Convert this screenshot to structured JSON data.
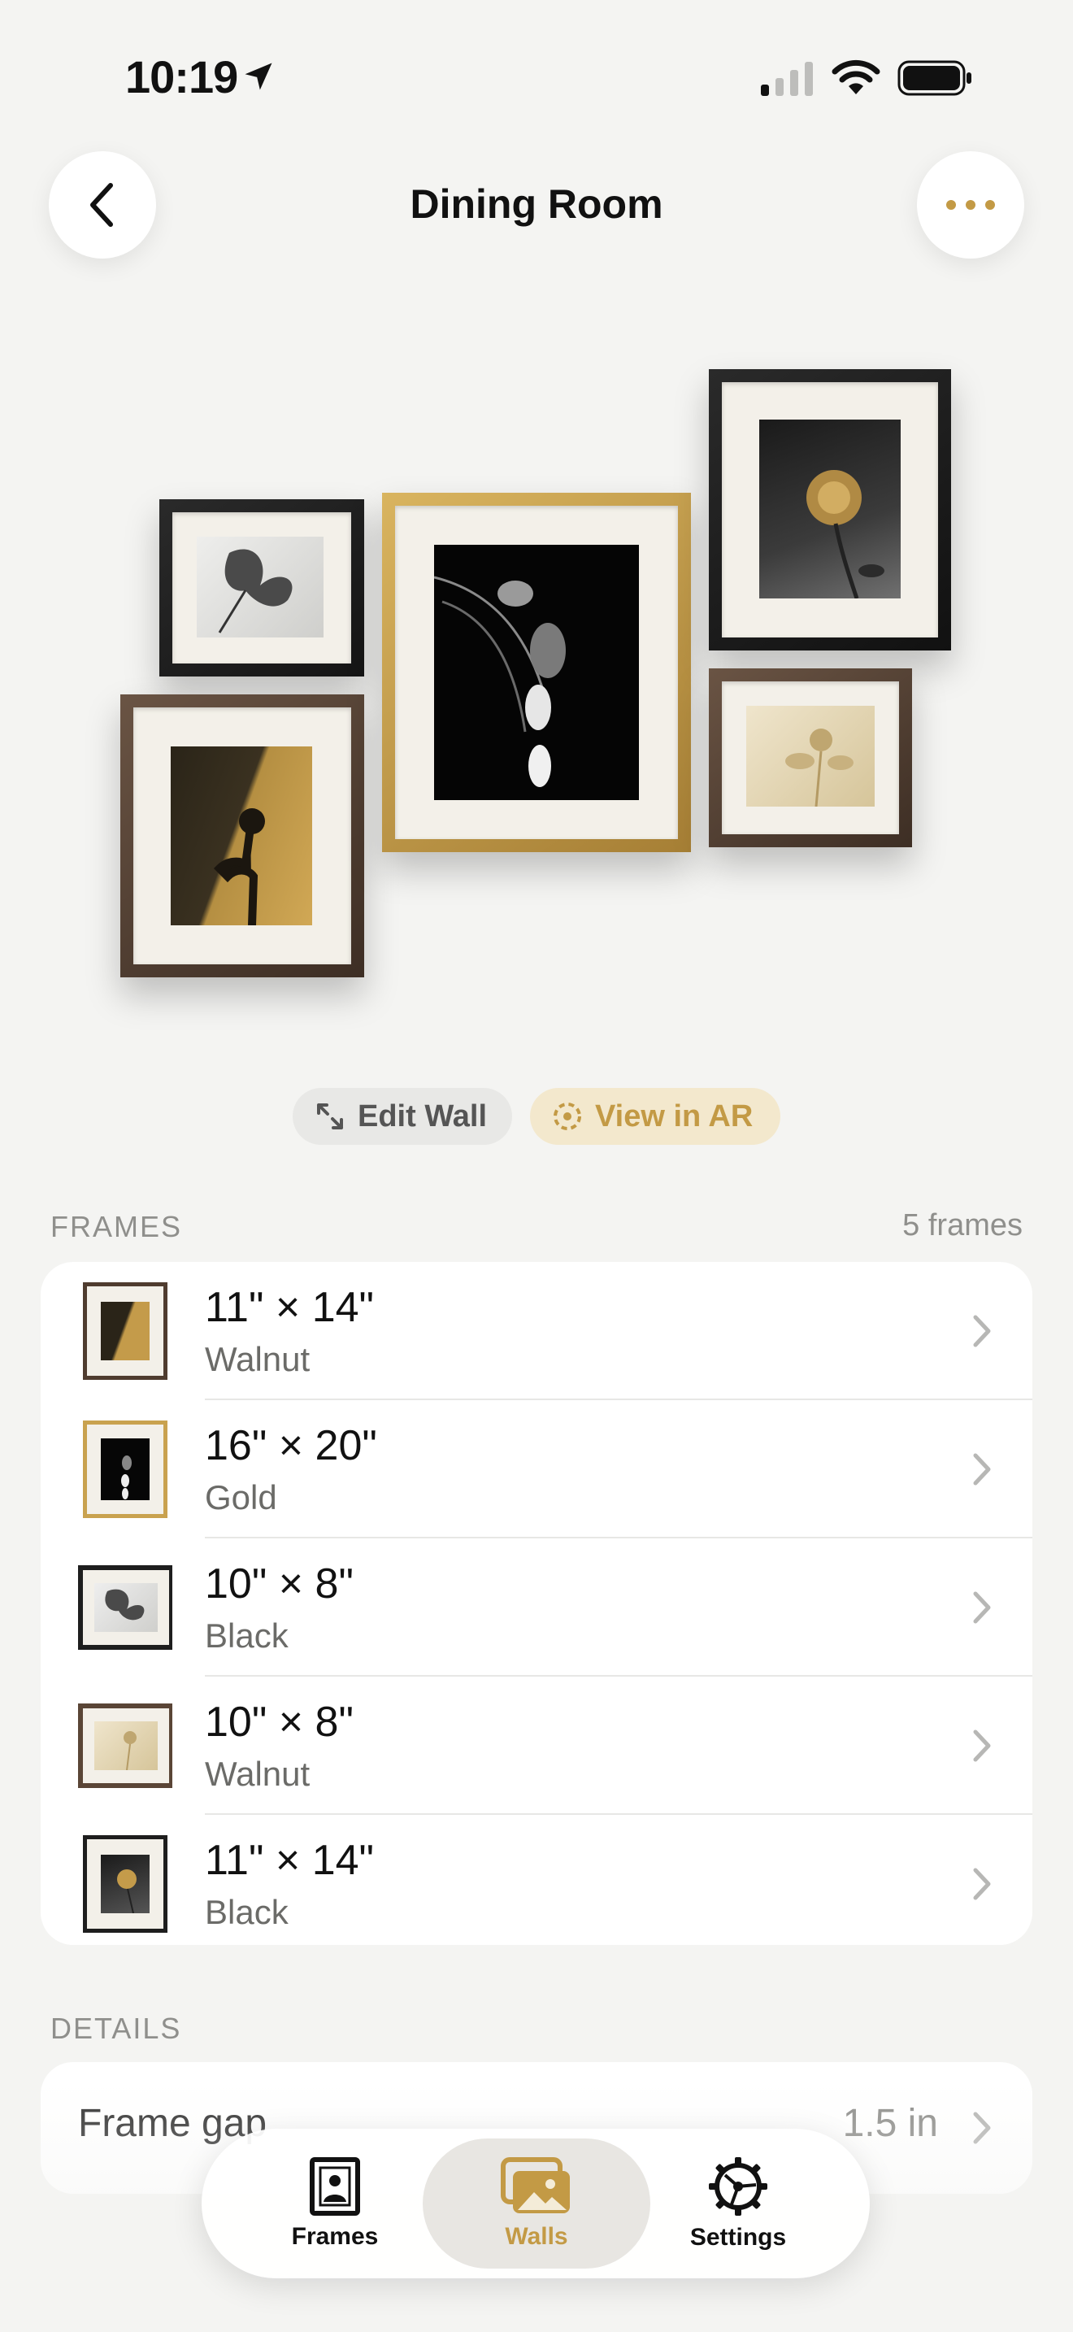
{
  "status_bar": {
    "time": "10:19",
    "icons": [
      "location-arrow-icon",
      "cellular-signal-icon",
      "wifi-icon",
      "battery-icon"
    ]
  },
  "nav": {
    "title": "Dining Room",
    "back_icon": "chevron-left-icon",
    "more_icon": "ellipsis-icon"
  },
  "actions": {
    "edit_wall": "Edit Wall",
    "view_ar": "View in AR"
  },
  "frames_section": {
    "label": "FRAMES",
    "count": "5 frames",
    "items": [
      {
        "size": "11\" × 14\"",
        "finish": "Walnut"
      },
      {
        "size": "16\" × 20\"",
        "finish": "Gold"
      },
      {
        "size": "10\" × 8\"",
        "finish": "Black"
      },
      {
        "size": "10\" × 8\"",
        "finish": "Walnut"
      },
      {
        "size": "11\" × 14\"",
        "finish": "Black"
      }
    ]
  },
  "details_section": {
    "label": "DETAILS",
    "items": [
      {
        "label": "Frame gap",
        "value": "1.5 in"
      }
    ]
  },
  "tab_bar": {
    "items": [
      {
        "label": "Frames",
        "icon": "framed-portrait-icon"
      },
      {
        "label": "Walls",
        "icon": "photos-stack-icon"
      },
      {
        "label": "Settings",
        "icon": "gear-icon"
      }
    ],
    "active": "Walls"
  },
  "colors": {
    "accent": "#c39a45",
    "walnut": "#5a4536",
    "gold": "#c9a24f",
    "black": "#1e1e1e"
  }
}
